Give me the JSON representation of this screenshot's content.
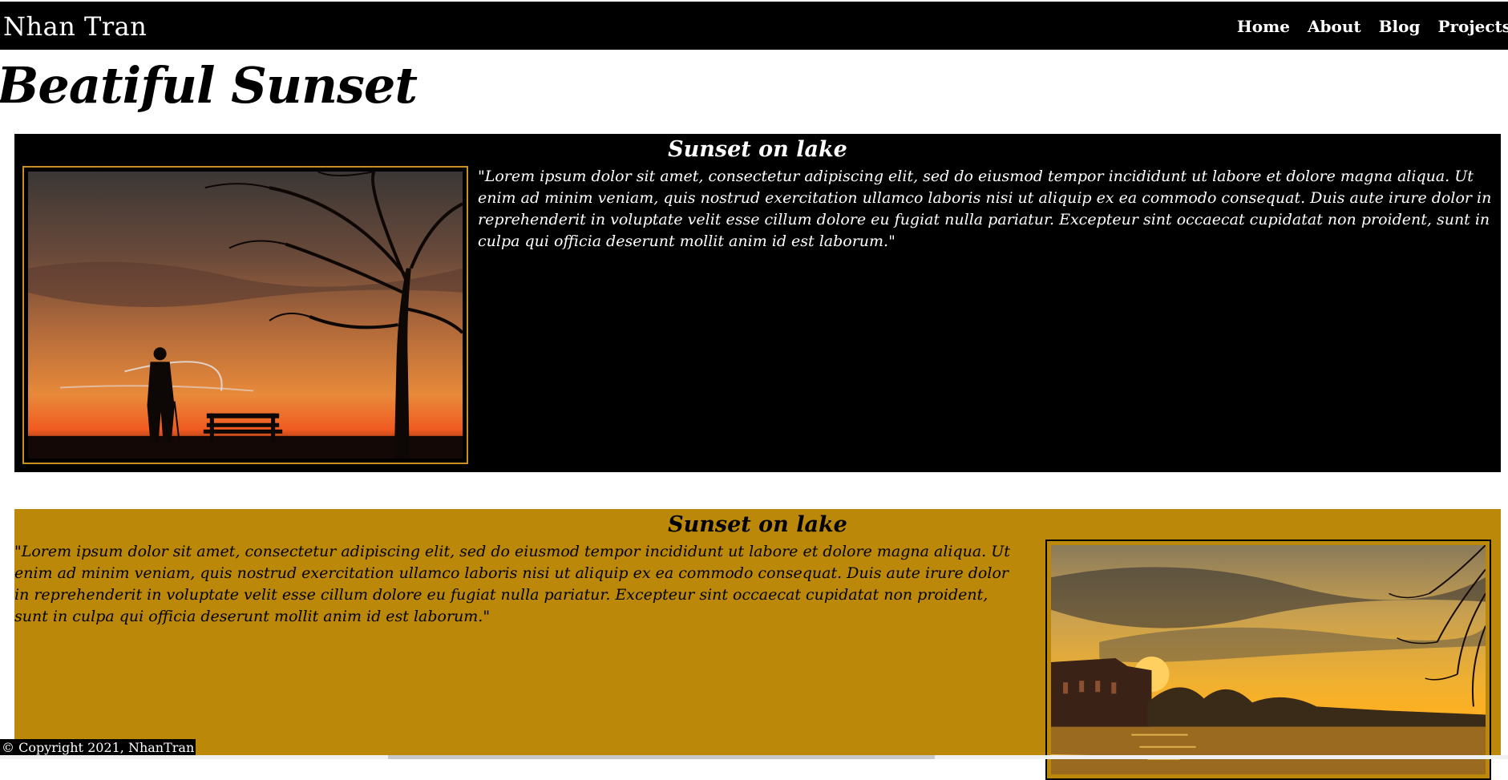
{
  "navbar": {
    "brand": "Nhan Tran",
    "links": [
      "Home",
      "About",
      "Blog",
      "Projects"
    ]
  },
  "page": {
    "title": "Beatiful Sunset"
  },
  "sections": [
    {
      "title": "Sunset on lake",
      "text": "\"Lorem ipsum dolor sit amet, consectetur adipiscing elit, sed do eiusmod tempor incididunt ut labore et dolore magna aliqua. Ut enim ad minim veniam, quis nostrud exercitation ullamco laboris nisi ut aliquip ex ea commodo consequat. Duis aute irure dolor in reprehenderit in voluptate velit esse cillum dolore eu fugiat nulla pariatur. Excepteur sint occaecat cupidatat non proident, sunt in culpa qui officia deserunt mollit anim id est laborum.\"",
      "background": "#000000",
      "frame_color": "#c8901e"
    },
    {
      "title": "Sunset on lake",
      "text": "\"Lorem ipsum dolor sit amet, consectetur adipiscing elit, sed do eiusmod tempor incididunt ut labore et dolore magna aliqua. Ut enim ad minim veniam, quis nostrud exercitation ullamco laboris nisi ut aliquip ex ea commodo consequat. Duis aute irure dolor in reprehenderit in voluptate velit esse cillum dolore eu fugiat nulla pariatur. Excepteur sint occaecat cupidatat non proident, sunt in culpa qui officia deserunt mollit anim id est laborum.\"",
      "background": "#bb880a",
      "frame_color": "#000000"
    }
  ],
  "footer": {
    "copyright": "© Copyright 2021, NhanTran"
  },
  "colors": {
    "accent_gold": "#bb880a",
    "nav_bg": "#000000"
  }
}
